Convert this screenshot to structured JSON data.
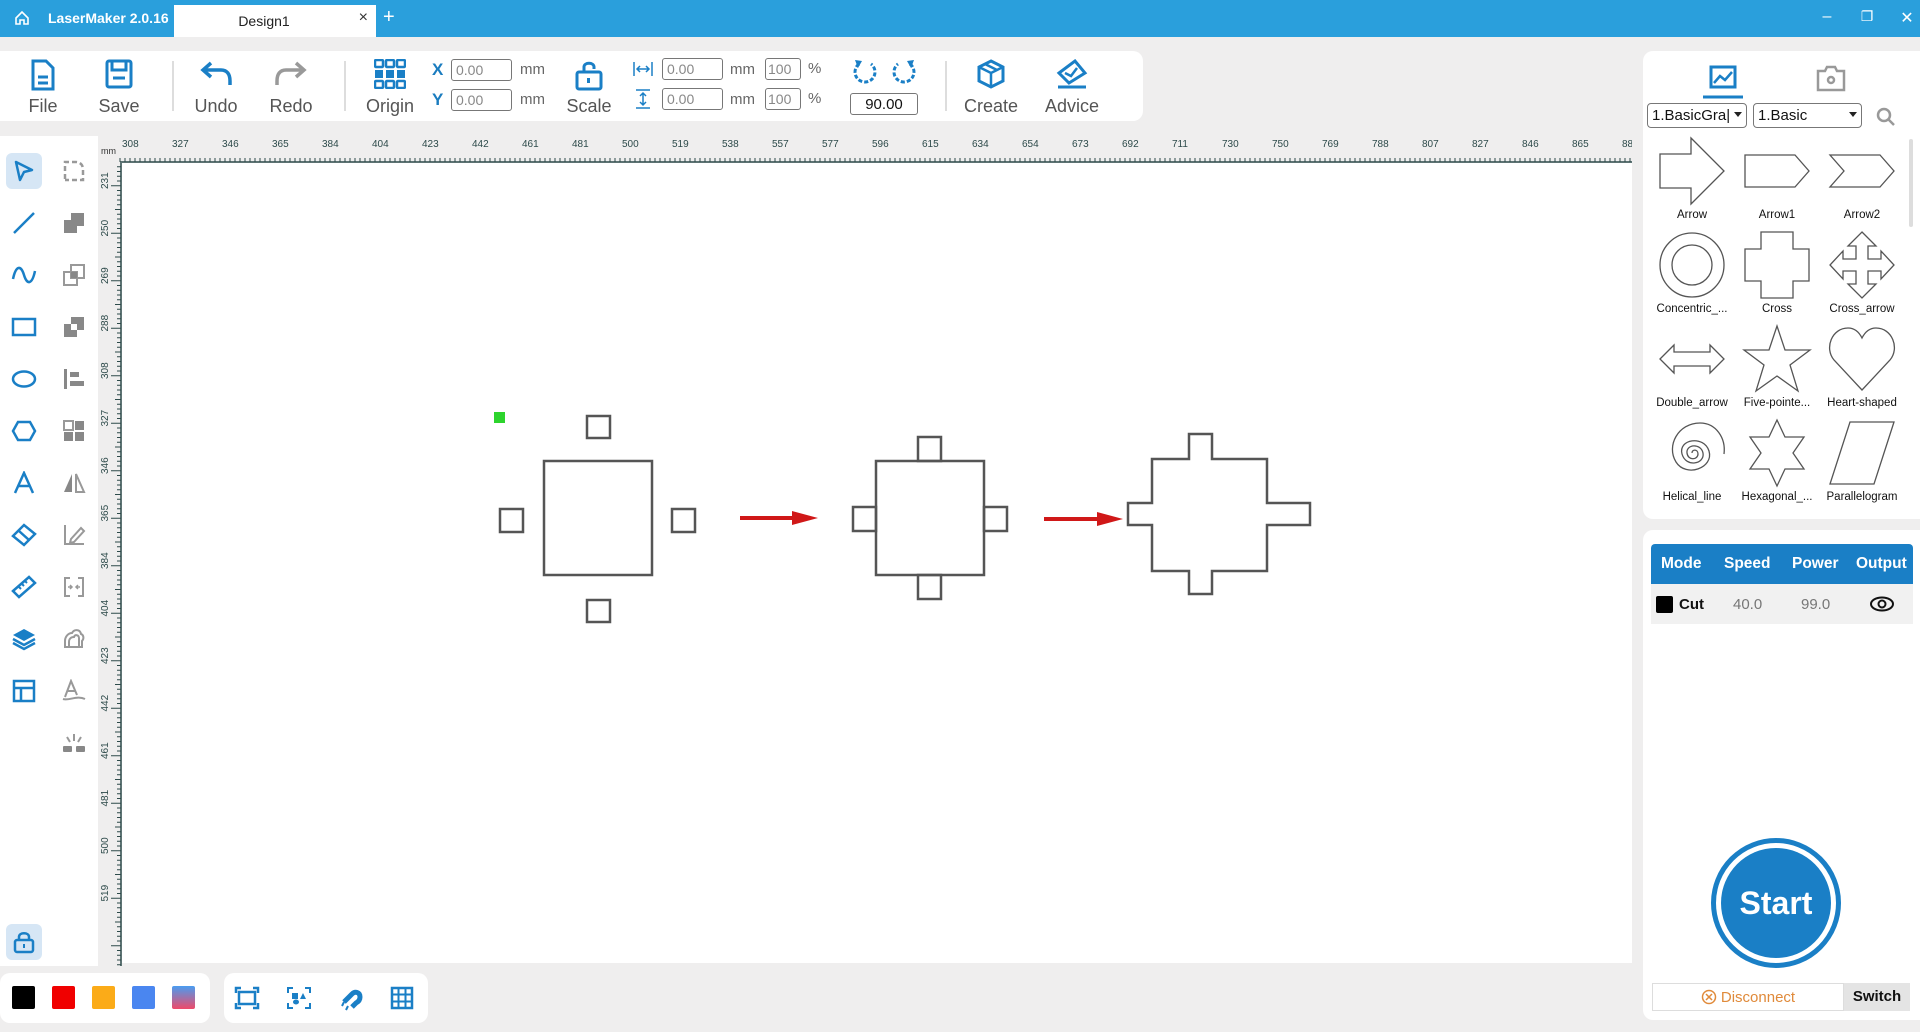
{
  "titlebar": {
    "app_name": "LaserMaker 2.0.16",
    "tab_label": "Design1",
    "close_tab": "×",
    "add_tab": "+",
    "minimize": "–",
    "restore": "❐",
    "close": "✕"
  },
  "toolbar": {
    "file": "File",
    "save": "Save",
    "undo": "Undo",
    "redo": "Redo",
    "origin": "Origin",
    "x_label": "X",
    "y_label": "Y",
    "x_value": "0.00",
    "y_value": "0.00",
    "unit": "mm",
    "scale": "Scale",
    "width_value": "0.00",
    "height_value": "0.00",
    "width_pct": "100",
    "height_pct": "100",
    "pct": "%",
    "rotation_value": "90.00",
    "create": "Create",
    "advice": "Advice"
  },
  "left_tools": [
    {
      "name": "select-tool",
      "active": true
    },
    {
      "name": "line-tool"
    },
    {
      "name": "curve-tool"
    },
    {
      "name": "rectangle-tool"
    },
    {
      "name": "ellipse-tool"
    },
    {
      "name": "polygon-tool"
    },
    {
      "name": "text-tool"
    },
    {
      "name": "eraser-tool"
    },
    {
      "name": "measure-tool"
    },
    {
      "name": "layers-tool"
    },
    {
      "name": "layout-tool"
    }
  ],
  "right_tools": [
    {
      "name": "round-corner-tool"
    },
    {
      "name": "union-tool"
    },
    {
      "name": "intersect-tool"
    },
    {
      "name": "subtract-tool"
    },
    {
      "name": "align-tool"
    },
    {
      "name": "array-tool"
    },
    {
      "name": "mirror-tool"
    },
    {
      "name": "edit-node-tool"
    },
    {
      "name": "center-tool"
    },
    {
      "name": "offset-tool"
    },
    {
      "name": "text-path-tool"
    },
    {
      "name": "laser-tool"
    }
  ],
  "ruler": {
    "unit": "mm",
    "h_ticks": [
      "308",
      "327",
      "346",
      "365",
      "384",
      "404",
      "423",
      "442",
      "461",
      "481",
      "500",
      "519",
      "538",
      "557",
      "577",
      "596",
      "615",
      "634",
      "654",
      "673",
      "692",
      "711",
      "730",
      "750",
      "769",
      "788",
      "807",
      "827",
      "846",
      "865",
      "88"
    ],
    "v_ticks": [
      "231",
      "250",
      "269",
      "288",
      "308",
      "327",
      "346",
      "365",
      "384",
      "404",
      "423",
      "442",
      "461",
      "481",
      "500",
      "519"
    ]
  },
  "colors": {
    "swatches": [
      "#000000",
      "#f00000",
      "#fbab18",
      "#4a86f0",
      "gradient"
    ],
    "accent": "#1a7fc6",
    "titlebar": "#2a9fdc"
  },
  "bottom_tools": [
    "fit-screen",
    "select-all-objects",
    "magnet-snap",
    "grid"
  ],
  "library": {
    "category": "1.BasicGraphics",
    "category_display": "1.BasicGra|",
    "subcategory": "1.Basic",
    "shapes": [
      "Arrow",
      "Arrow1",
      "Arrow2",
      "Concentric_...",
      "Cross",
      "Cross_arrow",
      "Double_arrow",
      "Five-pointe...",
      "Heart-shaped",
      "Helical_line",
      "Hexagonal_...",
      "Parallelogram"
    ]
  },
  "layers": {
    "headers": [
      "Mode",
      "Speed",
      "Power",
      "Output"
    ],
    "rows": [
      {
        "color": "#000000",
        "mode": "Cut",
        "speed": "40.0",
        "power": "99.0",
        "output": "visible"
      }
    ]
  },
  "actions": {
    "start": "Start",
    "disconnect": "Disconnect",
    "switch": "Switch"
  }
}
